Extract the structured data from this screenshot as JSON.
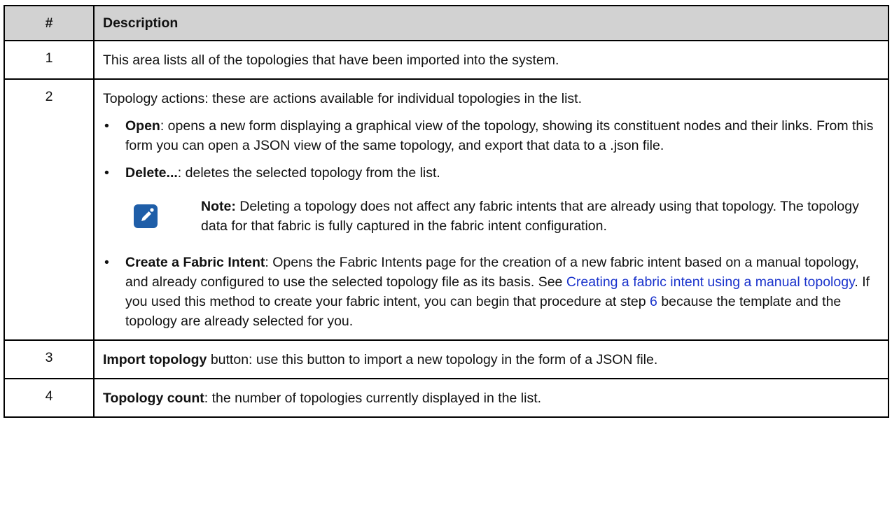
{
  "table": {
    "headers": {
      "num": "#",
      "desc": "Description"
    },
    "row1": {
      "num": "1",
      "text": "This area lists all of the topologies that have been imported into the system."
    },
    "row2": {
      "num": "2",
      "intro": "Topology actions: these are actions available for individual topologies in the list.",
      "open_term": "Open",
      "open_text": ": opens a new form displaying a graphical view of the topology, showing its constituent nodes and their links. From this form you can open a JSON view of the same topology, and export that data to a .json file.",
      "delete_term": "Delete...",
      "delete_text": ": deletes the selected topology from the list.",
      "note_label": "Note:",
      "note_text": " Deleting a topology does not affect any fabric intents that are already using that topology. The topology data for that fabric is fully captured in the fabric intent configuration.",
      "create_term": "Create a Fabric Intent",
      "create_text_1": ": Opens the Fabric Intents page for the creation of a new fabric intent based on a manual topology, and already configured to use the selected topology file as its basis. See ",
      "create_link": "Creating a fabric intent using a manual topology",
      "create_text_2": ". If you used this method to create your fabric intent, you can begin that procedure at step ",
      "create_step": "6",
      "create_text_3": " because the template and the topology are already selected for you."
    },
    "row3": {
      "num": "3",
      "term": "Import topology",
      "text": " button: use this button to import a new topology in the form of a JSON file."
    },
    "row4": {
      "num": "4",
      "term": "Topology count",
      "text": ": the number of topologies currently displayed in the list."
    }
  },
  "icons": {
    "note": "note-pencil-icon"
  },
  "colors": {
    "header_bg": "#d2d2d2",
    "link": "#1a33cc",
    "note_icon": "#1f5ea8"
  }
}
